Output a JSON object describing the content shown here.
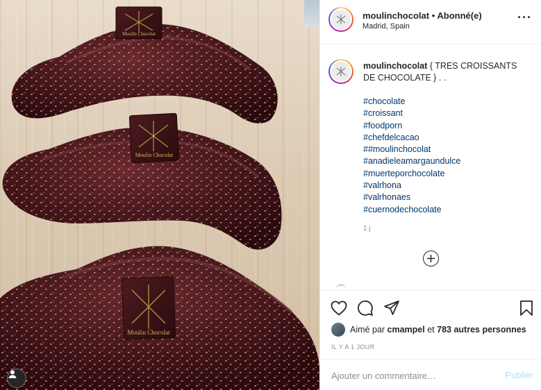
{
  "post": {
    "photo": {
      "product_label": "Moulin Chocolat"
    },
    "header": {
      "username": "moulinchocolat",
      "separator": "•",
      "follow_status": "Abonné(e)",
      "location": "Madrid, Spain",
      "more_icon": "more-horizontal-icon"
    },
    "caption": {
      "username": "moulinchocolat",
      "text": "{ TRES CROISSANTS DE CHOCOLATE } . .",
      "hashtags": [
        "#chocolate",
        "#croissant",
        "#foodporn",
        "#chefdelcacao",
        "##moulinchocolat",
        "#anadieleamargaundulce",
        "#muerteporchocolate",
        "#valrhona",
        "#valrhonaes",
        "#cuernodechocolate"
      ],
      "time": "1 j"
    },
    "actions": {
      "icons": [
        "heart-icon",
        "comment-icon",
        "share-icon",
        "bookmark-icon"
      ],
      "likes_prefix": "Aimé par",
      "liker": "cmampel",
      "likes_middle": "et",
      "likes_count_text": "783 autres personnes",
      "posted_ago": "IL Y A 1 JOUR"
    },
    "comment_box": {
      "placeholder": "Ajouter un commentaire…",
      "submit_label": "Publier"
    }
  },
  "colors": {
    "link": "#00376b",
    "muted": "#8e8e8e",
    "publish_disabled": "#b2dffc",
    "chocolate": "#3f1216"
  }
}
